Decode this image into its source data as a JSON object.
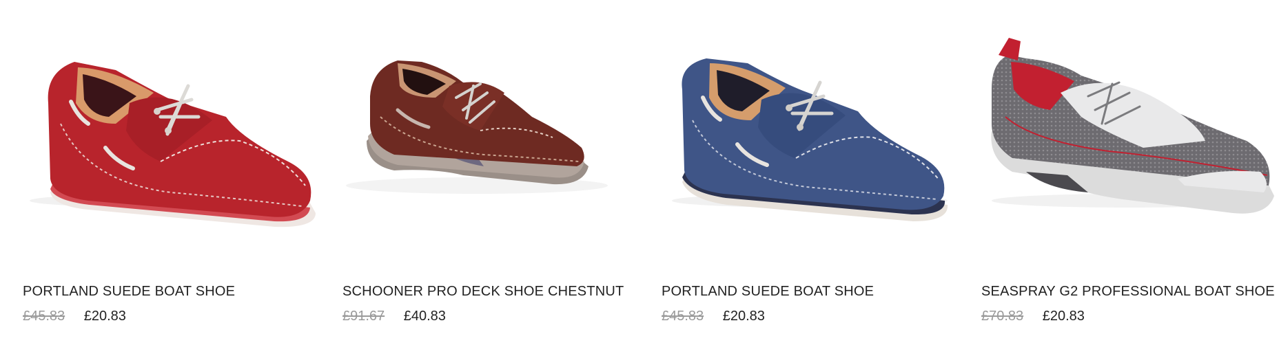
{
  "products": [
    {
      "name": "PORTLAND SUEDE BOAT SHOE",
      "old_price": "£45.83",
      "price": "£20.83",
      "image": "red-suede-boat-shoe"
    },
    {
      "name": "SCHOONER PRO DECK SHOE CHESTNUT",
      "old_price": "£91.67",
      "price": "£40.83",
      "image": "chestnut-leather-deck-shoe"
    },
    {
      "name": "PORTLAND SUEDE BOAT SHOE",
      "old_price": "£45.83",
      "price": "£20.83",
      "image": "navy-suede-boat-shoe"
    },
    {
      "name": "SEASPRAY G2 PROFESSIONAL BOAT SHOE",
      "old_price": "£70.83",
      "price": "£20.83",
      "image": "grey-mesh-sport-boat-shoe"
    }
  ],
  "colors": {
    "red_suede": "#b8242c",
    "chestnut": "#6e2a22",
    "navy_suede": "#3f5587",
    "grey_mesh": "#6d6b70",
    "old_price": "#9a9a9a",
    "text": "#222222"
  }
}
